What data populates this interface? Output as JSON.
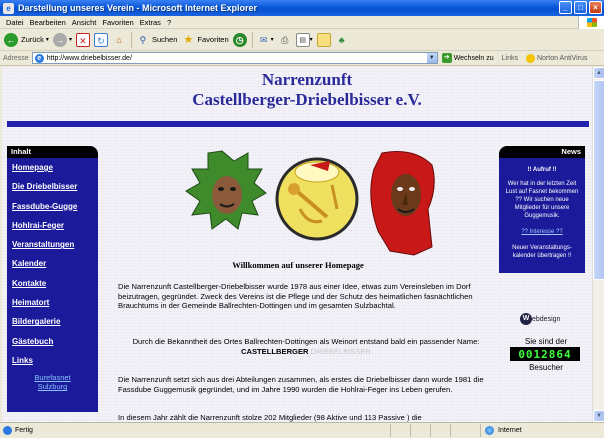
{
  "window": {
    "title": "Darstellung unseres Verein - Microsoft Internet Explorer",
    "controls": [
      "_",
      "□",
      "×"
    ]
  },
  "menu": [
    "Datei",
    "Bearbeiten",
    "Ansicht",
    "Favoriten",
    "Extras",
    "?"
  ],
  "toolbar": {
    "back_label": "Zurück",
    "search_label": "Suchen",
    "favorites_label": "Favoriten"
  },
  "addressbar": {
    "label": "Adresse",
    "url": "http://www.driebelbisser.de/",
    "go_label": "Wechseln zu",
    "links_label": "Links",
    "norton_label": "Norton AntiVirus"
  },
  "site": {
    "title_line1": "Narrenzunft",
    "title_line2": "Castellberger-Driebelbisser e.V."
  },
  "nav": {
    "header": "Inhalt",
    "items": [
      "Homepage",
      "Die Driebelbisser",
      "Fassdube-Gugge",
      "Hohlrai-Feger",
      "Veranstaltungen",
      "Kalender",
      "Kontakte",
      "Heimatort",
      "Bildergalerie",
      "Gästebuch",
      "Links"
    ],
    "special_line1": "Burefasnet",
    "special_line2": "Sulzburg"
  },
  "news": {
    "header": "News",
    "aufruf": "!! Aufruf !!",
    "text": "Wer hat in der letzten Zeit Lust auf Fasnet bekommen ?? Wir suchen neue Mitglieder für unsere Guggemusik.",
    "interest_link": "?? Interesse ??",
    "kalender_note": "Neuer Veranstaltungs-kalender übertragen !!"
  },
  "webdesign_label": "ebdesign",
  "counter": {
    "label": "Sie sind der",
    "value": "0012864",
    "suffix": "Besucher"
  },
  "main": {
    "welcome": "Willkommen auf unserer Homepage",
    "p1": "Die Narrenzunft Castellberger-Driebelbisser wurde 1978 aus einer Idee, etwas zum Vereinsleben im Dorf beizutragen, gegründet. Zweck des Vereins ist die Pflege und der Schutz des heimatlichen fasnächtlichen Brauchtums in der Gemeinde Ballrechten-Dottingen und im gesamten Sulzbachtal.",
    "p2": "Durch die Bekanntheit des Ortes Ballrechten-Dottingen als Weinort entstand bald ein passender Name:",
    "name_bold": "CASTELLBERGER",
    "name_grey": "DRIEBELBISSER",
    "p3": "Die Narrenzunft setzt sich aus drei Abteilungen zusammen, als erstes die Driebelbisser dann wurde 1981 die Fassdube Guggemusik gegründet, und im Jahre 1990 wurden die Hohlrai-Feger ins Leben gerufen.",
    "p4": "In diesem Jahr zählt die Narrenzunft stolze 202 Mitglieder (98 Aktive und 113 Passive ) die"
  },
  "status": {
    "left": "Fertig",
    "zone": "Internet"
  },
  "colors": {
    "nav_bg": "#1a1a9a",
    "title_text": "#2a2a9a",
    "counter_digits": "#3cff3c"
  }
}
